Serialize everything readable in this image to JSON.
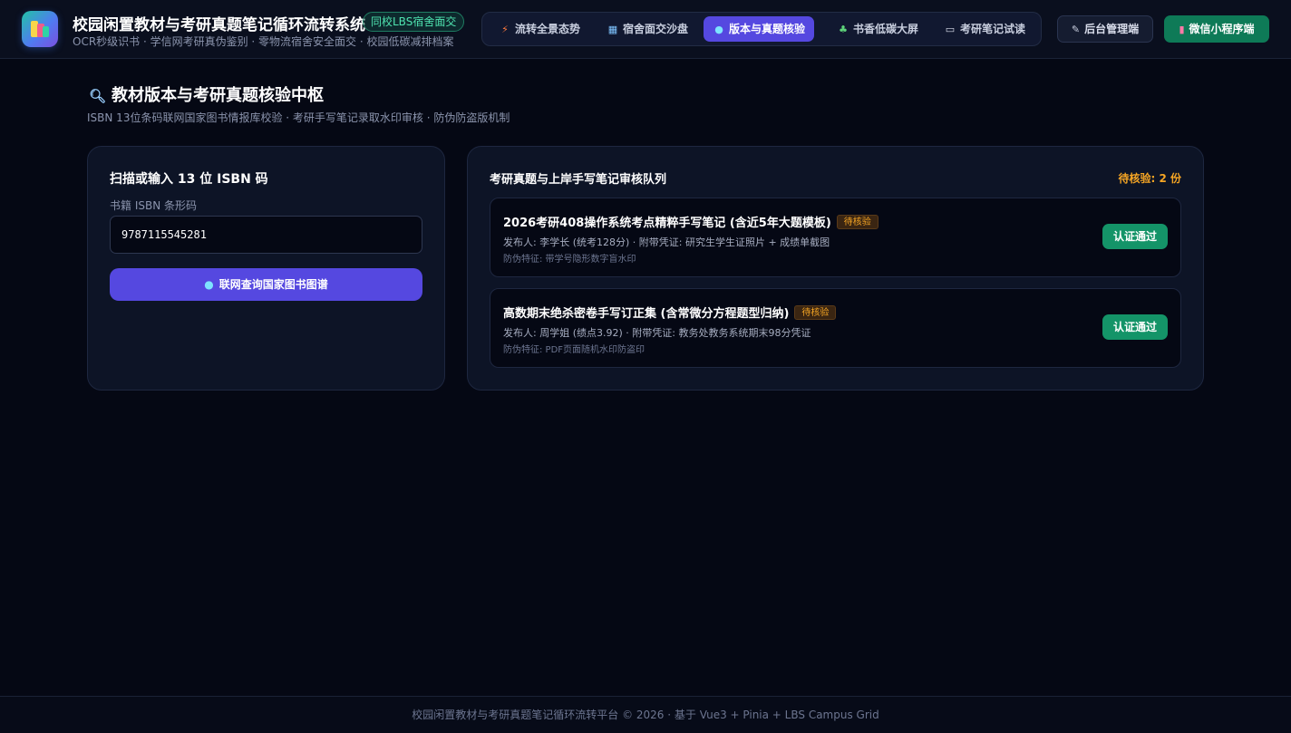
{
  "header": {
    "title": "校园闲置教材与考研真题笔记循环流转系统",
    "badge": "同校LBS宿舍面交",
    "subtitle": "OCR秒级识书 · 学信网考研真伪鉴别 · 零物流宿舍安全面交 · 校园低碳减排档案"
  },
  "nav": {
    "items": [
      {
        "label": "流转全景态势",
        "icon": "lightning-icon",
        "active": false
      },
      {
        "label": "宿舍面交沙盘",
        "icon": "map-icon",
        "active": false
      },
      {
        "label": "版本与真题核验",
        "icon": "dot-icon",
        "active": true
      },
      {
        "label": "书香低碳大屏",
        "icon": "sprout-icon",
        "active": false
      },
      {
        "label": "考研笔记试读",
        "icon": "book-icon",
        "active": false
      }
    ],
    "admin_label": "后台管理端",
    "miniprogram_label": "微信小程序端"
  },
  "page": {
    "title": "教材版本与考研真题核验中枢",
    "subtitle": "ISBN 13位条码联网国家图书情报库校验 · 考研手写笔记录取水印审核 · 防伪防盗版机制"
  },
  "isbn_panel": {
    "title": "扫描或输入 13 位 ISBN 码",
    "field_label": "书籍 ISBN 条形码",
    "value": "9787115545281",
    "query_button": "联网查询国家图书图谱"
  },
  "review_queue": {
    "title": "考研真题与上岸手写笔记审核队列",
    "pending_count": "待核验: 2 份",
    "items": [
      {
        "title": "2026考研408操作系统考点精粹手写笔记 (含近5年大题模板)",
        "status": "待核验",
        "meta": "发布人: 李学长 (统考128分) · 附带凭证: 研究生学生证照片 + 成绩单截图",
        "feature": "防伪特征: 带学号隐形数字盲水印",
        "action": "认证通过"
      },
      {
        "title": "高数期末绝杀密卷手写订正集 (含常微分方程题型归纳)",
        "status": "待核验",
        "meta": "发布人: 周学姐 (绩点3.92) · 附带凭证: 教务处教务系统期末98分凭证",
        "feature": "防伪特征: PDF页面随机水印防盗印",
        "action": "认证通过"
      }
    ]
  },
  "footer": {
    "text": "校园闲置教材与考研真题笔记循环流转平台 © 2026 · 基于 Vue3 + Pinia + LBS Campus Grid"
  },
  "colors": {
    "accent": "#5548e0",
    "success": "#149468",
    "warning": "#f5a524",
    "background": "#050814"
  }
}
